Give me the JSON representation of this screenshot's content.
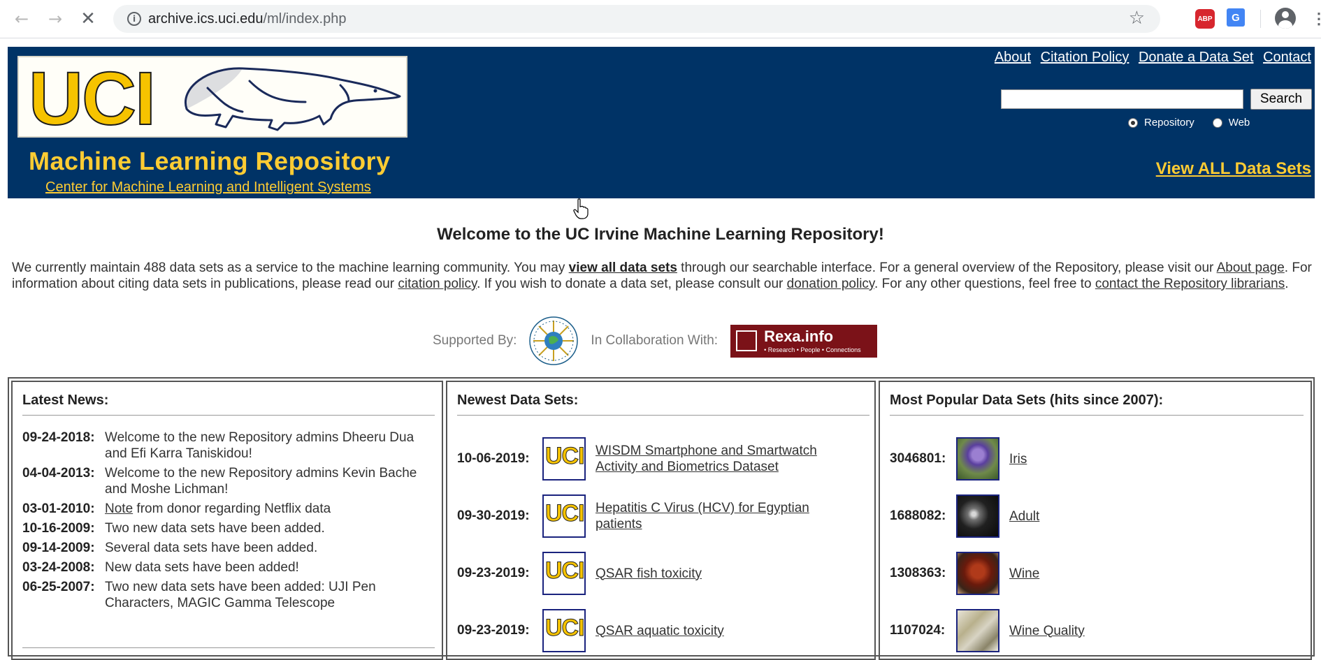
{
  "browser": {
    "url_host": "archive.ics.uci.edu",
    "url_path": "/ml/index.php",
    "ext_abp_label": "ABP",
    "ext_translate_label": "G"
  },
  "header": {
    "logo_text": "UCI",
    "title": "Machine Learning Repository",
    "subtitle": "Center for Machine Learning and Intelligent Systems",
    "links": [
      "About",
      "Citation Policy",
      "Donate a Data Set",
      "Contact"
    ],
    "search_value": "",
    "search_button": "Search",
    "radio_repository": "Repository",
    "radio_web": "Web",
    "radio_selected": "Repository",
    "view_all": "View ALL Data Sets"
  },
  "welcome": {
    "title": "Welcome to the UC Irvine Machine Learning Repository!",
    "p1": "We currently maintain 488 data sets as a service to the machine learning community. You may ",
    "link_view_all": "view all data sets",
    "p2": " through our searchable interface. For a general overview of the Repository, please visit our ",
    "link_about": "About page",
    "p3": ". For information about citing data sets in publications, please read our ",
    "link_citation": "citation policy",
    "p4": ". If you wish to donate a data set, please consult our ",
    "link_donation": "donation policy",
    "p5": ". For any other questions, feel free to ",
    "link_contact": "contact the Repository librarians",
    "p6": "."
  },
  "support": {
    "supported_by": "Supported By:",
    "collaboration": "In Collaboration With:",
    "rexa_name": "Rexa.info",
    "rexa_tag": "• Research • People • Connections"
  },
  "news": {
    "title": "Latest News:",
    "items": [
      {
        "date": "09-24-2018:",
        "text": "Welcome to the new Repository admins Dheeru Dua and Efi Karra Taniskidou!"
      },
      {
        "date": "04-04-2013:",
        "text": "Welcome to the new Repository admins Kevin Bache and Moshe Lichman!"
      },
      {
        "date": "03-01-2010:",
        "link": "Note",
        "text": " from donor regarding Netflix data"
      },
      {
        "date": "10-16-2009:",
        "text": "Two new data sets have been added."
      },
      {
        "date": "09-14-2009:",
        "text": "Several data sets have been added."
      },
      {
        "date": "03-24-2008:",
        "text": "New data sets have been added!"
      },
      {
        "date": "06-25-2007:",
        "text": "Two new data sets have been added: UJI Pen Characters, MAGIC Gamma Telescope"
      }
    ]
  },
  "newest": {
    "title": "Newest Data Sets:",
    "items": [
      {
        "date": "10-06-2019:",
        "name": "WISDM Smartphone and Smartwatch Activity and Biometrics Dataset"
      },
      {
        "date": "09-30-2019:",
        "name": "Hepatitis C Virus (HCV) for Egyptian patients"
      },
      {
        "date": "09-23-2019:",
        "name": "QSAR fish toxicity"
      },
      {
        "date": "09-23-2019:",
        "name": "QSAR aquatic toxicity"
      }
    ]
  },
  "popular": {
    "title": "Most Popular Data Sets (hits since 2007):",
    "items": [
      {
        "hits": "3046801:",
        "name": "Iris"
      },
      {
        "hits": "1688082:",
        "name": "Adult"
      },
      {
        "hits": "1308363:",
        "name": "Wine"
      },
      {
        "hits": "1107024:",
        "name": "Wine Quality"
      }
    ]
  },
  "colors": {
    "header_bg": "#003366",
    "gold": "#ffcc33"
  }
}
